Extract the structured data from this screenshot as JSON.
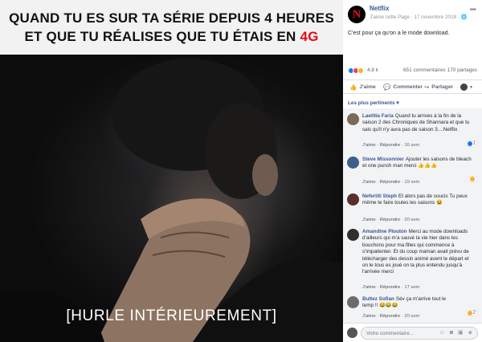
{
  "meme": {
    "header_line1": "QUAND TU ES SUR TA SÉRIE DEPUIS 4 HEURES",
    "header_line2_prefix": "ET QUE TU RÉALISES QUE TU ÉTAIS EN ",
    "header_line2_accent": "4G",
    "caption": "[HURLE INTÉRIEUREMENT]",
    "accent_color": "#e50914"
  },
  "post": {
    "page_logo_letter": "N",
    "page_name": "Netflix",
    "page_meta": "J'aime cette Page · 17 novembre 2018 · 🌐",
    "more_icon": "•••",
    "text": "C'est pour ça qu'on a le mode download.",
    "reactions_count": "4,8 k",
    "comments_count": "651 commentaires",
    "shares_count": "170 partages",
    "actions": {
      "like": "J'aime",
      "comment": "Commenter",
      "share": "Partager"
    },
    "sort_label": "Les plus pertinents ▾"
  },
  "comments": [
    {
      "author": "Laetitia Faria",
      "text": "Quand tu arrives à la fin de la saison 2 des Chroniques de Shannara et que tu sais qu'il n'y aura pas de saison 3....Netflix",
      "like": "J'aime",
      "reply": "Répondre",
      "time": "16 sem",
      "reaction_count": "1",
      "avatar_color": "#7a6a5a"
    },
    {
      "author": "Steve Missonnier",
      "text": "Ajouter les saisons de bleach et one punch man merci 👍👍👍",
      "like": "J'aime",
      "reply": "Répondre",
      "time": "19 sem",
      "reaction_count": "",
      "avatar_color": "#3e5f8a"
    },
    {
      "author": "Nefertiti Steph",
      "text": "Et alors pas de soucis Tu peux même te faire toutes les saisons 😆",
      "like": "J'aime",
      "reply": "Répondre",
      "time": "20 sem",
      "reaction_count": "",
      "avatar_color": "#5a2e2e"
    },
    {
      "author": "Amandine Plouton",
      "text": "Merci au mode downloads d'ailleurs qui m'a sauvé la vie hier dans les bouchons pour ma filles qui commence à s'impatienter. Et du coup maman avait prévu de télécharger des dessin animé avent le départ et on le tous es joué on la plus entendu jusqu'à l'arrivée merci",
      "like": "J'aime",
      "reply": "Répondre",
      "time": "17 sem",
      "reaction_count": "",
      "avatar_color": "#2f2f2f"
    },
    {
      "author": "Bultez Sofian",
      "text": "Sév ça m'arrive tout le temp !! 😂😂😂",
      "like": "J'aime",
      "reply": "Répondre",
      "time": "20 sem",
      "reaction_count": "2",
      "avatar_color": "#6b6b6b"
    }
  ],
  "composer": {
    "placeholder": "Votre commentaire...",
    "icons": "☺ ◙ ▣ ◈"
  }
}
